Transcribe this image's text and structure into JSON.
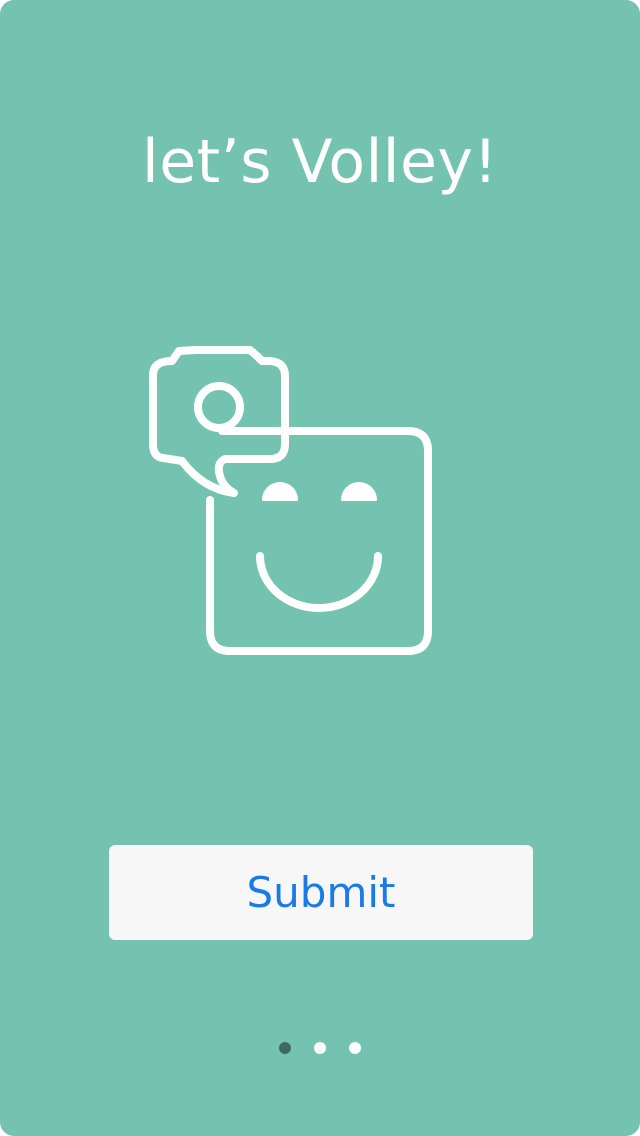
{
  "onboarding": {
    "title": "let’s Volley!",
    "illustration_icon": "camera-speech-bubble-smiley-icon",
    "submit_label": "Submit",
    "page_indicator": {
      "total": 3,
      "current": 1
    }
  },
  "colors": {
    "background": "#74c2b0",
    "button_background": "#f7f7f7",
    "button_text": "#1a7be7",
    "dot_active": "#3f6860",
    "dot_inactive": "#ffffff"
  }
}
